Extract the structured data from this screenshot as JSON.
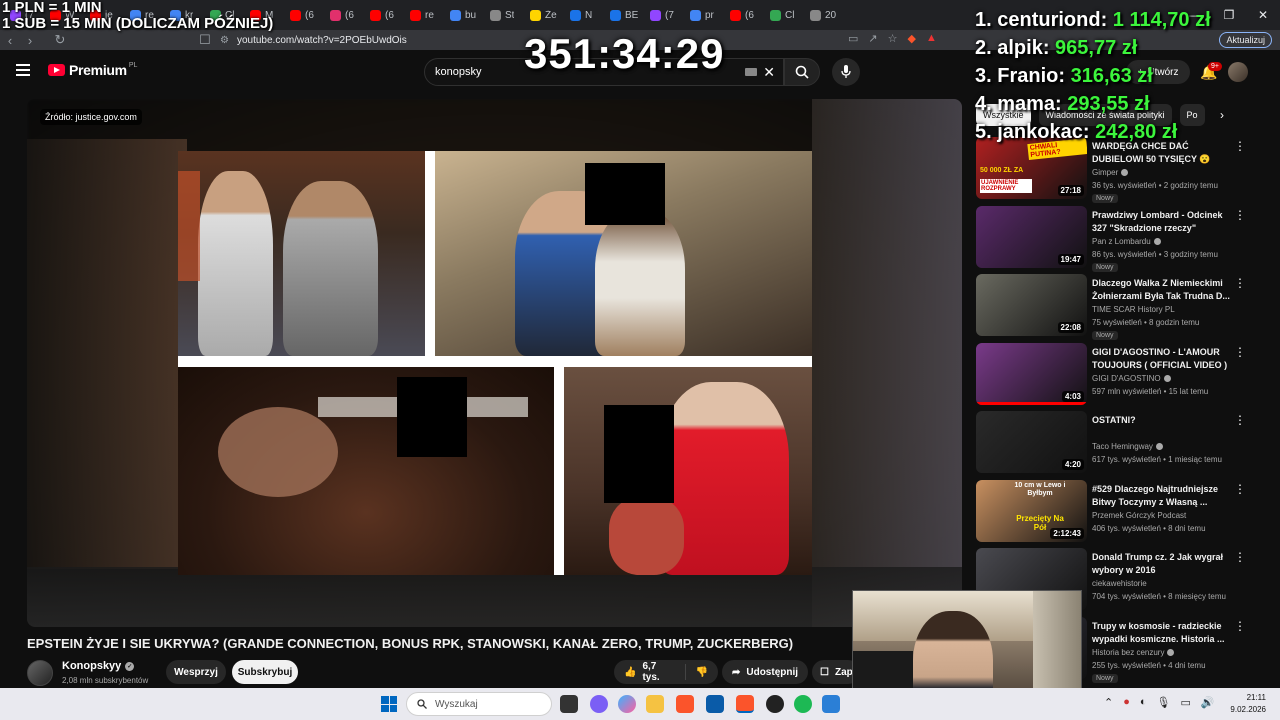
{
  "overlay": {
    "rate_line1": "1 PLN = 1 MIN",
    "rate_line2": "1 SUB = 15 MIN (DOLICZAM PÓŹNIEJ)",
    "timer": "351:34:29"
  },
  "leaderboard": [
    {
      "rank_name": "1. centuriond:",
      "amount": "1 114,70 zł"
    },
    {
      "rank_name": "2. alpik:",
      "amount": "965,77 zł"
    },
    {
      "rank_name": "3. Franio:",
      "amount": "316,63 zł"
    },
    {
      "rank_name": "4. mama:",
      "amount": "293,55 zł"
    },
    {
      "rank_name": "5. jankokac:",
      "amount": "242,80 zł"
    }
  ],
  "browser": {
    "tabs": [
      "(7",
      "W",
      "je",
      "re",
      "kr",
      "Cl",
      "M",
      "(6",
      "(6",
      "(6",
      "re",
      "bu",
      "St",
      "Že",
      "N",
      "BE",
      "(7",
      "pr",
      "(6",
      "Cl",
      "20"
    ],
    "url": "youtube.com/watch?v=2POEbUwdOis",
    "update_label": "Aktualizuj"
  },
  "youtube": {
    "logo_text": "Premium",
    "logo_region": "PL",
    "search_value": "konopsky",
    "create_label": "Utwórz",
    "notif_count": "9+"
  },
  "video": {
    "source_badge": "Źródło: justice.gov.com",
    "title": "EPSTEIN ŻYJE I SIE UKRYWA? (GRANDE CONNECTION, BONUS RPK, STANOWSKI, KANAŁ ZERO, TRUMP, ZUCKERBERG)",
    "channel_name": "Konopskyy",
    "channel_subs": "2,08 mln subskrybentów",
    "support_label": "Wesprzyj",
    "subscribe_label": "Subskrybuj",
    "likes": "6,7 tys.",
    "share_label": "Udostępnij",
    "save_label": "Zapisz"
  },
  "chips": [
    "Wszystkie",
    "Wiadomości ze świata polityki",
    "Po"
  ],
  "recommendations": [
    {
      "title": "WARDĘGA CHCE DAĆ DUBIELOWI 50 TYSIĘCY 😮",
      "channel": "Gimper",
      "verified": true,
      "meta": "36 tys. wyświetleń • 2 godziny temu",
      "badge": "Nowy",
      "duration": "27:18",
      "thumb": "#b02020"
    },
    {
      "title": "Prawdziwy Lombard - Odcinek 327 \"Skradzione rzeczy\"",
      "channel": "Pan z Lombardu",
      "verified": true,
      "meta": "86 tys. wyświetleń • 3 godziny temu",
      "badge": "Nowy",
      "duration": "19:47",
      "thumb": "#5a2a6a"
    },
    {
      "title": "Dlaczego Walka Z Niemieckimi Żołnierzami Była Tak Trudna D...",
      "channel": "TIME SCAR History PL",
      "verified": false,
      "meta": "75 wyświetleń • 8 godzin temu",
      "badge": "Nowy",
      "duration": "22:08",
      "thumb": "#6a6a60"
    },
    {
      "title": "GIGI D'AGOSTINO - L'AMOUR TOUJOURS ( OFFICIAL VIDEO )",
      "channel": "GIGI D'AGOSTINO",
      "verified": true,
      "meta": "597 mln wyświetleń • 15 lat temu",
      "badge": "",
      "duration": "4:03",
      "thumb": "#7a3a8a"
    },
    {
      "title": "OSTATNI?",
      "channel": "Taco Hemingway",
      "verified": true,
      "meta": "617 tys. wyświetleń • 1 miesiąc temu",
      "badge": "",
      "duration": "4:20",
      "thumb": "#2a2a2a"
    },
    {
      "title": "#529 Dlaczego Najtrudniejsze Bitwy Toczymy z Własną ...",
      "channel": "Przemek Górczyk Podcast",
      "verified": false,
      "meta": "406 tys. wyświetleń • 8 dni temu",
      "badge": "",
      "duration": "2:12:43",
      "thumb": "#c89060"
    },
    {
      "title": "Donald Trump cz. 2 Jak wygrał wybory w 2016",
      "channel": "ciekawehistorie",
      "verified": false,
      "meta": "704 tys. wyświetleń • 8 miesięcy temu",
      "badge": "",
      "duration": "",
      "thumb": "#4a4a50"
    },
    {
      "title": "Trupy w kosmosie - radzieckie wypadki kosmiczne. Historia ...",
      "channel": "Historia bez cenzury",
      "verified": true,
      "meta": "255 tys. wyświetleń • 4 dni temu",
      "badge": "Nowy",
      "duration": "",
      "thumb": "#3a3a4a"
    }
  ],
  "rec_thumb_text": {
    "r1_top": "CHWALI PUTINA?",
    "r1_mid": "50 000 ZŁ ZA",
    "r1_bot": "UJAWNIENIE ROZPRAWY",
    "r6_top": "10 cm w Lewo i Byłbym",
    "r6_bot": "Przecięty Na Pół"
  },
  "taskbar": {
    "search_placeholder": "Wyszukaj",
    "time": "21:11",
    "date": "9.02.2026"
  },
  "colors": {
    "accent_red": "#ff0033",
    "leaderboard_green": "#3cf53c"
  }
}
